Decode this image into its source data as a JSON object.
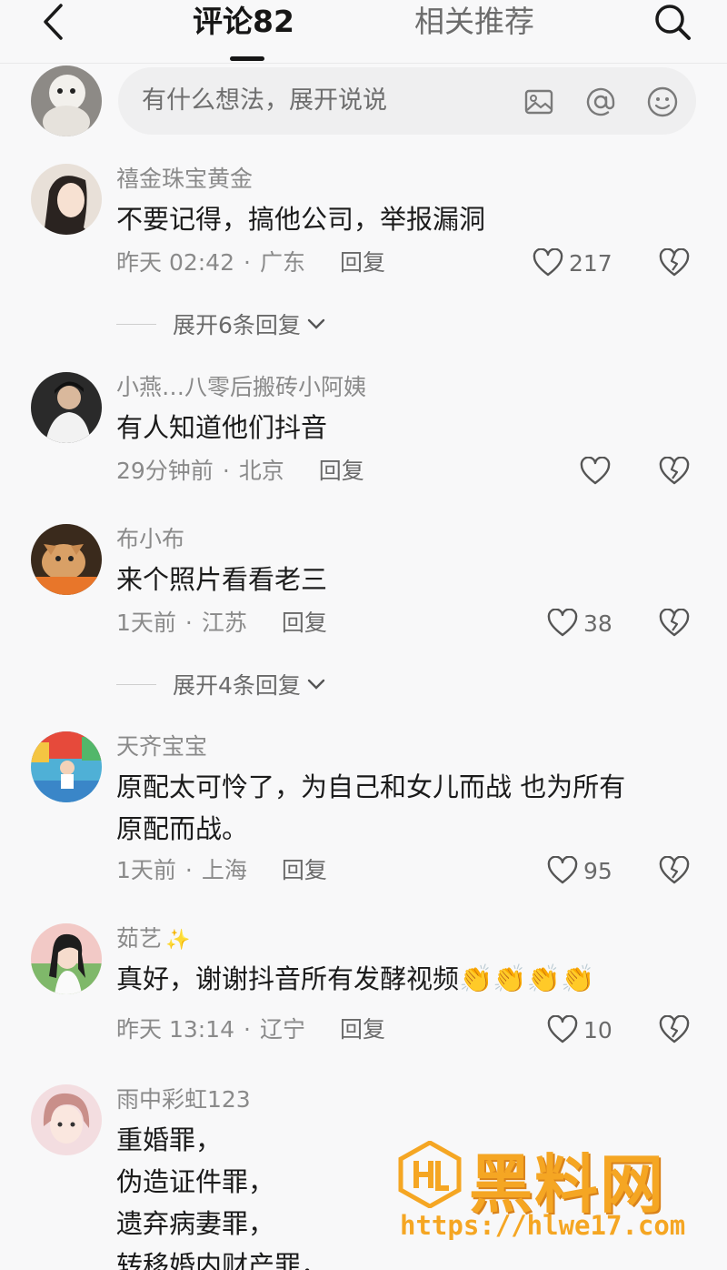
{
  "header": {
    "tab_comments": "评论82",
    "tab_related": "相关推荐"
  },
  "composer": {
    "placeholder": "有什么想法，展开说说"
  },
  "comments": [
    {
      "author": "禧金珠宝黄金",
      "text": "不要记得，搞他公司，举报漏洞",
      "time": "昨天 02:42",
      "location": "广东",
      "reply": "回复",
      "likes": "217",
      "expand": "展开6条回复"
    },
    {
      "author": "小燕…八零后搬砖小阿姨",
      "text": "有人知道他们抖音",
      "time": "29分钟前",
      "location": "北京",
      "reply": "回复",
      "likes": ""
    },
    {
      "author": "布小布",
      "text": "来个照片看看老三",
      "time": "1天前",
      "location": "江苏",
      "reply": "回复",
      "likes": "38",
      "expand": "展开4条回复"
    },
    {
      "author": "天齐宝宝",
      "text": "原配太可怜了，为自己和女儿而战 也为所有\n原配而战。",
      "time": "1天前",
      "location": "上海",
      "reply": "回复",
      "likes": "95"
    },
    {
      "author": "茹艺",
      "text": "真好，谢谢抖音所有发酵视频",
      "emojis": "👏👏👏👏",
      "time": "昨天 13:14",
      "location": "辽宁",
      "reply": "回复",
      "likes": "10"
    },
    {
      "author": "雨中彩虹123",
      "text": "重婚罪，\n伪造证件罪，\n遗弃病妻罪，\n转移婚内财产罪，"
    }
  ],
  "watermark": {
    "title": "黑料网",
    "url": "https://hlwe17.com"
  },
  "colors": {
    "background": "#f8f8f9",
    "text_primary": "#1b1b1b",
    "text_secondary": "#8a8a8a",
    "watermark": "#f5a623"
  }
}
